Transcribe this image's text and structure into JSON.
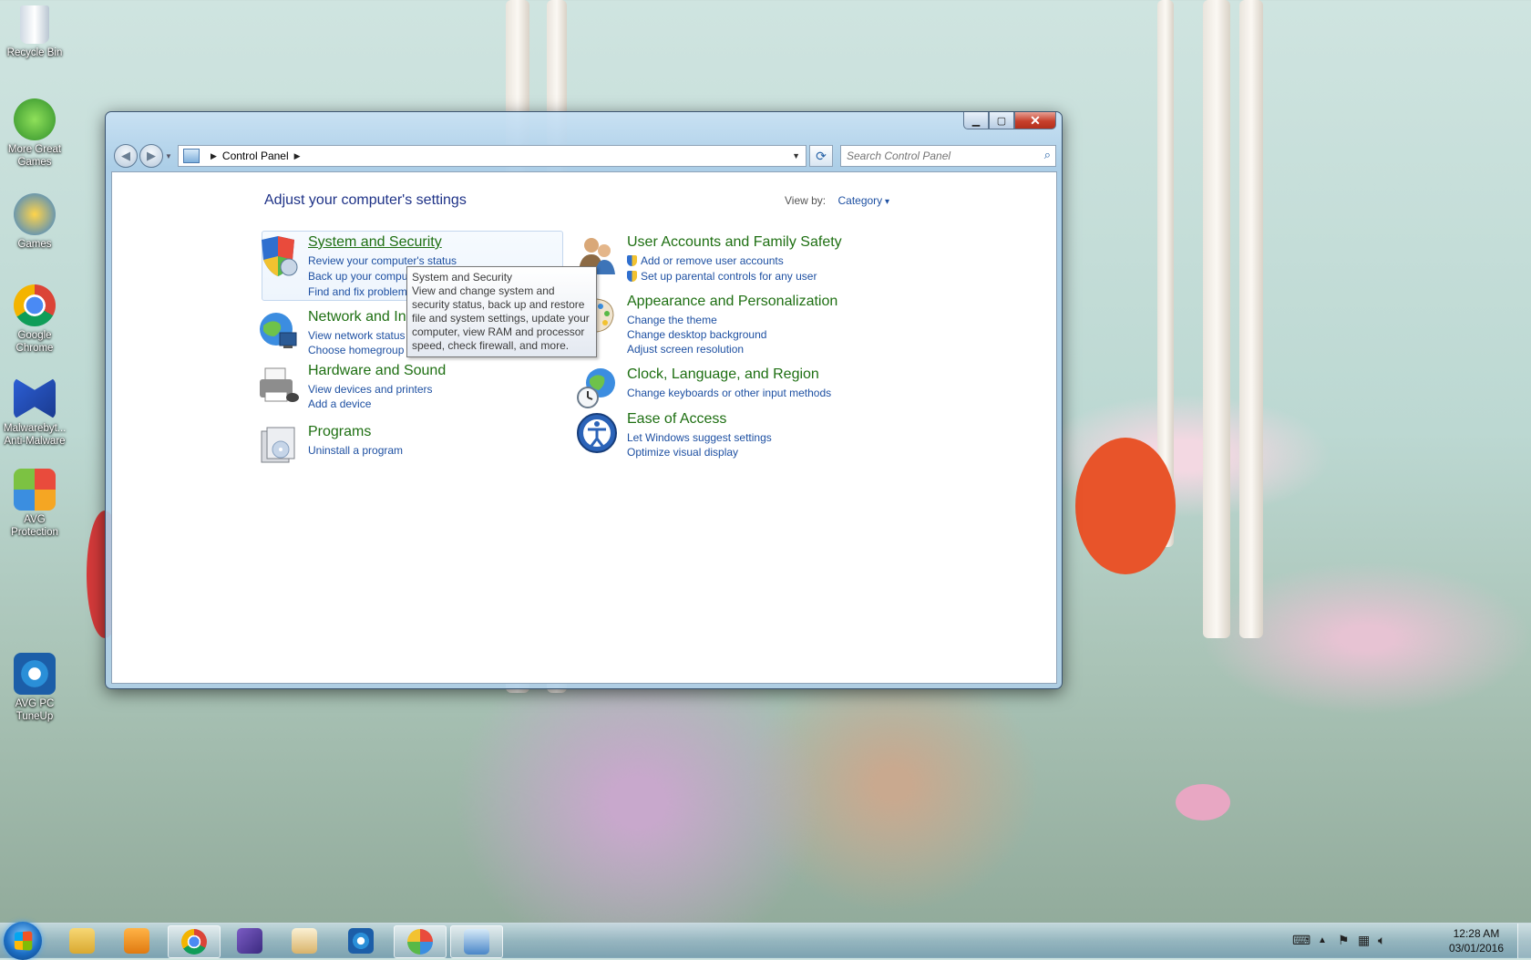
{
  "desktop": {
    "icons": [
      {
        "label": "Recycle Bin"
      },
      {
        "label": "More Great Games"
      },
      {
        "label": "Games"
      },
      {
        "label": "Google Chrome"
      },
      {
        "label": "Malwarebyt... Anti-Malware"
      },
      {
        "label": "AVG Protection"
      },
      {
        "label": "AVG PC TuneUp"
      }
    ]
  },
  "window": {
    "address": {
      "root": "Control Panel"
    },
    "search": {
      "placeholder": "Search Control Panel"
    },
    "page_title": "Adjust your computer's settings",
    "view_by": {
      "label": "View by:",
      "value": "Category"
    },
    "categories_left": [
      {
        "title": "System and Security",
        "links": [
          "Review your computer's status",
          "Back up your compu",
          "Find and fix problem"
        ]
      },
      {
        "title": "Network and In",
        "links": [
          "View network status",
          "Choose homegroup"
        ]
      },
      {
        "title": "Hardware and Sound",
        "links": [
          "View devices and printers",
          "Add a device"
        ]
      },
      {
        "title": "Programs",
        "links": [
          "Uninstall a program"
        ]
      }
    ],
    "categories_right": [
      {
        "title": "User Accounts and Family Safety",
        "links": [
          "Add or remove user accounts",
          "Set up parental controls for any user"
        ]
      },
      {
        "title": "Appearance and Personalization",
        "links": [
          "Change the theme",
          "Change desktop background",
          "Adjust screen resolution"
        ]
      },
      {
        "title": "Clock, Language, and Region",
        "links": [
          "Change keyboards or other input methods"
        ]
      },
      {
        "title": "Ease of Access",
        "links": [
          "Let Windows suggest settings",
          "Optimize visual display"
        ]
      }
    ],
    "tooltip": {
      "title": "System and Security",
      "body": "View and change system and security status, back up and restore file and system settings, update your computer, view RAM and processor speed, check firewall, and more."
    }
  },
  "taskbar": {
    "clock_time": "12:28 AM",
    "clock_date": "03/01/2016"
  },
  "colors": {
    "category_title": "#1e6f12",
    "link": "#1e50a2",
    "page_title": "#1e3287",
    "arrow": "#9b3c9a"
  }
}
